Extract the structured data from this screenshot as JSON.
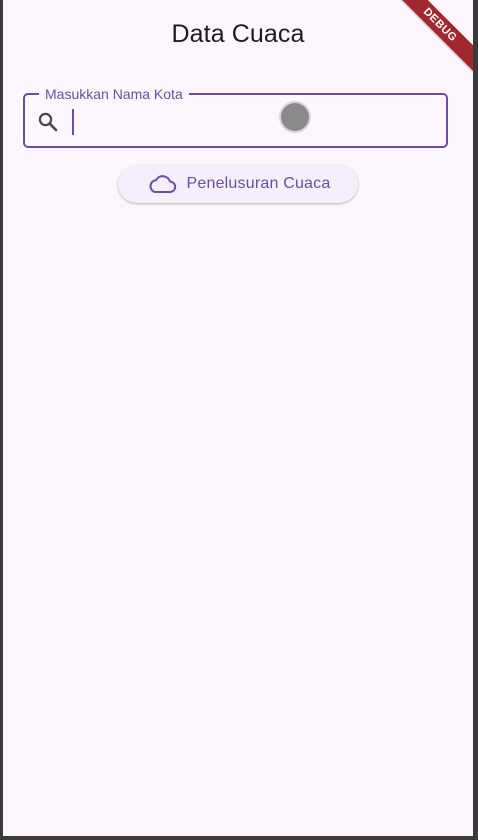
{
  "app_bar": {
    "title": "Data Cuaca"
  },
  "search_field": {
    "label": "Masukkan Nama Kota",
    "value": "",
    "icon": "search-icon"
  },
  "action_button": {
    "label": "Penelusuran Cuaca",
    "icon": "cloud-icon"
  },
  "debug_banner": {
    "text": "DEBUG"
  },
  "colors": {
    "primary": "#6750a4",
    "background": "#fdf7fd",
    "button_background": "#f6eff9",
    "debug_banner": "#a3272f",
    "title_text": "#1d1b20"
  }
}
